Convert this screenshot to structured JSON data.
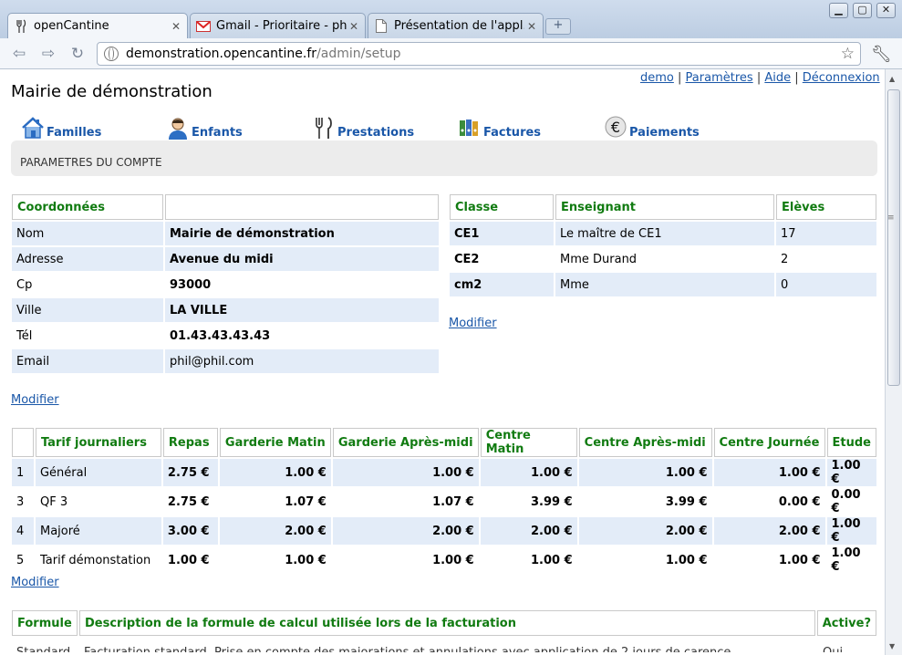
{
  "browser": {
    "tabs": [
      {
        "label": "openCantine",
        "icon": "fork-knife-icon"
      },
      {
        "label": "Gmail - Prioritaire - ph…",
        "icon": "gmail-icon"
      },
      {
        "label": "Présentation de l'appl…",
        "icon": "page-icon"
      }
    ],
    "url_host": "demonstration.opencantine.fr",
    "url_path": "/admin/setup"
  },
  "header": {
    "site_title": "Mairie de démonstration",
    "links": [
      "demo",
      "Paramètres",
      "Aide",
      "Déconnexion"
    ],
    "separator": "|"
  },
  "nav": [
    {
      "label": "Familles",
      "icon": "house-icon"
    },
    {
      "label": "Enfants",
      "icon": "child-icon"
    },
    {
      "label": "Prestations",
      "icon": "fork-knife-icon"
    },
    {
      "label": "Factures",
      "icon": "binders-icon"
    },
    {
      "label": "Paiements",
      "icon": "euro-icon"
    }
  ],
  "section_title": "PARAMETRES DU COMPTE",
  "coordonnees": {
    "headers": [
      "Coordonnées",
      ""
    ],
    "rows": [
      {
        "label": "Nom",
        "value": "Mairie de démonstration"
      },
      {
        "label": "Adresse",
        "value": "Avenue du midi"
      },
      {
        "label": "Cp",
        "value": "93000"
      },
      {
        "label": "Ville",
        "value": "LA VILLE"
      },
      {
        "label": "Tél",
        "value": "01.43.43.43.43"
      },
      {
        "label": "Email",
        "value": "phil@phil.com"
      }
    ],
    "modifier": "Modifier"
  },
  "classes": {
    "headers": [
      "Classe",
      "Enseignant",
      "Elèves"
    ],
    "rows": [
      {
        "classe": "CE1",
        "enseignant": "Le maître de CE1",
        "eleves": "17"
      },
      {
        "classe": "CE2",
        "enseignant": "Mme Durand",
        "eleves": "2"
      },
      {
        "classe": "cm2",
        "enseignant": "Mme",
        "eleves": "0"
      }
    ],
    "modifier": "Modifier"
  },
  "tarifs": {
    "headers": [
      "",
      "Tarif journaliers",
      "Repas",
      "Garderie Matin",
      "Garderie Après-midi",
      "Centre Matin",
      "Centre Après-midi",
      "Centre Journée",
      "Etude"
    ],
    "rows": [
      [
        "1",
        "Général",
        "2.75 €",
        "1.00 €",
        "1.00 €",
        "1.00 €",
        "1.00 €",
        "1.00 €",
        "1.00 €"
      ],
      [
        "3",
        "QF 3",
        "2.75 €",
        "1.07 €",
        "1.07 €",
        "3.99 €",
        "3.99 €",
        "0.00 €",
        "0.00 €"
      ],
      [
        "4",
        "Majoré",
        "3.00 €",
        "2.00 €",
        "2.00 €",
        "2.00 €",
        "2.00 €",
        "2.00 €",
        "1.00 €"
      ],
      [
        "5",
        "Tarif démonstation",
        "1.00 €",
        "1.00 €",
        "1.00 €",
        "1.00 €",
        "1.00 €",
        "1.00 €",
        "1.00 €"
      ]
    ],
    "modifier": "Modifier"
  },
  "formules": {
    "headers": [
      "Formule",
      "Description de la formule de calcul utilisée lors de la facturation",
      "Active?"
    ],
    "partial_row": [
      "Standard",
      "Facturation standard. Prise en compte des majorations et annulations avec application de 2 jours de carence",
      "Oui"
    ]
  },
  "colors": {
    "link": "#1a57a8",
    "header_text": "#117b11",
    "row_stripe": "#e3ecf8"
  }
}
